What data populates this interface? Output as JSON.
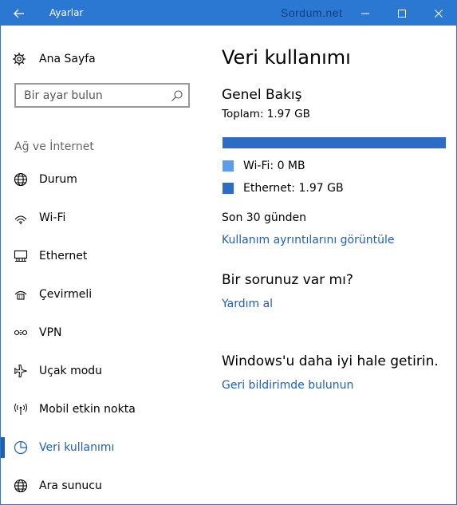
{
  "window": {
    "title": "Ayarlar",
    "watermark": "Sordum.net",
    "accent": "#2b78d3"
  },
  "sidebar": {
    "home_label": "Ana Sayfa",
    "search_placeholder": "Bir ayar bulun",
    "section_label": "Ağ ve İnternet",
    "items": [
      {
        "label": "Durum",
        "icon": "globe-status-icon"
      },
      {
        "label": "Wi-Fi",
        "icon": "wifi-icon"
      },
      {
        "label": "Ethernet",
        "icon": "ethernet-icon"
      },
      {
        "label": "Çevirmeli",
        "icon": "dialup-icon"
      },
      {
        "label": "VPN",
        "icon": "vpn-icon"
      },
      {
        "label": "Uçak modu",
        "icon": "airplane-icon"
      },
      {
        "label": "Mobil etkin nokta",
        "icon": "hotspot-icon"
      },
      {
        "label": "Veri kullanımı",
        "icon": "pie-chart-icon",
        "active": true
      },
      {
        "label": "Ara sunucu",
        "icon": "globe-proxy-icon"
      }
    ]
  },
  "main": {
    "title": "Veri kullanımı",
    "overview_heading": "Genel Bakış",
    "total": "Toplam: 1.97 GB",
    "usage_fraction_ethernet": 1.0,
    "legend": [
      {
        "label": "Wi-Fi: 0 MB",
        "color": "#5d9cec"
      },
      {
        "label": "Ethernet: 1.97 GB",
        "color": "#2d6cc6"
      }
    ],
    "period": "Son 30 günden",
    "details_link": "Kullanım ayrıntılarını görüntüle",
    "question_heading": "Bir sorunuz var mı?",
    "help_link": "Yardım al",
    "improve_heading": "Windows'u daha iyi hale getirin.",
    "feedback_link": "Geri bildirimde bulunun"
  }
}
